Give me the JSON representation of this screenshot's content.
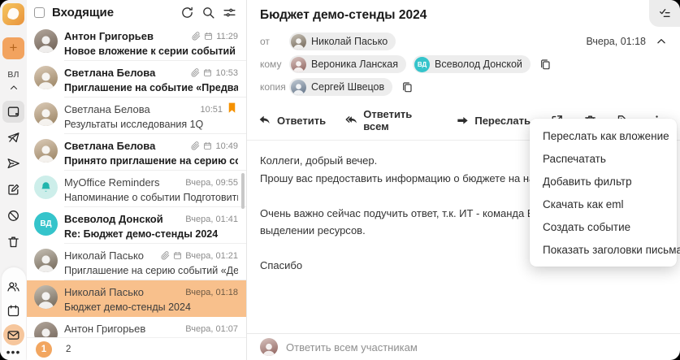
{
  "sidebar": {
    "plus_label": "+",
    "user_initials": "ВЛ"
  },
  "list_panel": {
    "title": "Входящие",
    "pagination": {
      "current": "1",
      "next": "2"
    },
    "emails": [
      {
        "sender": "Антон Григорьев",
        "subject": "Новое вложение к серии событий «Аналити…",
        "time": "11:29",
        "unread": true,
        "has_attachment": true,
        "has_event": true,
        "flagged": false,
        "selected": false
      },
      {
        "sender": "Светлана Белова",
        "subject": "Приглашение на событие «Предварительно…",
        "time": "10:53",
        "unread": true,
        "has_attachment": true,
        "has_event": true,
        "flagged": false,
        "selected": false
      },
      {
        "sender": "Светлана Белова",
        "subject": "Результаты исследования 1Q",
        "time": "10:51",
        "unread": false,
        "has_attachment": false,
        "has_event": false,
        "flagged": true,
        "selected": false
      },
      {
        "sender": "Светлана Белова",
        "subject": "Принято приглашение на серию событий «…",
        "time": "10:49",
        "unread": true,
        "has_attachment": true,
        "has_event": true,
        "flagged": false,
        "selected": false
      },
      {
        "sender": "MyOffice Reminders",
        "subject": "Напоминание о событии Подготовить отчет…",
        "time": "Вчера, 09:55",
        "unread": false,
        "has_attachment": false,
        "has_event": false,
        "flagged": false,
        "selected": false
      },
      {
        "sender": "Всеволод Донской",
        "subject": "Re: Бюджет демо-стенды 2024",
        "time": "Вчера, 01:41",
        "unread": true,
        "has_attachment": false,
        "has_event": false,
        "flagged": false,
        "selected": false,
        "avatar_text": "ВД"
      },
      {
        "sender": "Николай Пасько",
        "subject": "Приглашение на серию событий «Демо стен…",
        "time": "Вчера, 01:21",
        "unread": false,
        "has_attachment": true,
        "has_event": true,
        "flagged": false,
        "selected": false
      },
      {
        "sender": "Николай Пасько",
        "subject": "Бюджет демо-стенды 2024",
        "time": "Вчера, 01:18",
        "unread": false,
        "has_attachment": false,
        "has_event": false,
        "flagged": false,
        "selected": true
      },
      {
        "sender": "Антон Григорьев",
        "subject": "",
        "time": "Вчера, 01:07",
        "unread": false,
        "has_attachment": false,
        "has_event": false,
        "flagged": false,
        "selected": false
      }
    ]
  },
  "reading_pane": {
    "subject": "Бюджет демо-стенды 2024",
    "date": "Вчера, 01:18",
    "from_label": "от",
    "to_label": "кому",
    "cc_label": "копия",
    "from_chip": "Николай Пасько",
    "to_chips": [
      "Вероника Ланская",
      "Всеволод Донской"
    ],
    "to_chip2_avatar": "ВД",
    "cc_chip": "Сергей Швецов",
    "actions": {
      "reply": "Ответить",
      "reply_all": "Ответить всем",
      "forward": "Переслать"
    },
    "body_lines": [
      "Коллеги, добрый вечер.",
      "Прошу вас предоставить информацию о бюджете на наши демонстраци",
      "",
      "Очень важно сейчас подучить ответ, т.к. ИТ - команда Всеволода, уже",
      "выделении ресурсов.",
      "",
      "Спасибо"
    ],
    "reply_bar_text": "Ответить всем участникам"
  },
  "context_menu": {
    "items": [
      "Переслать как вложение",
      "Распечатать",
      "Добавить фильтр",
      "Скачать как eml",
      "Создать событие",
      "Показать заголовки письма"
    ]
  },
  "colors": {
    "accent_orange": "#F2A35F",
    "selected_row": "#F8C08C",
    "flag_orange": "#F59100",
    "teal_avatar": "#35C4CB",
    "chip_bg": "#EDEDED"
  }
}
